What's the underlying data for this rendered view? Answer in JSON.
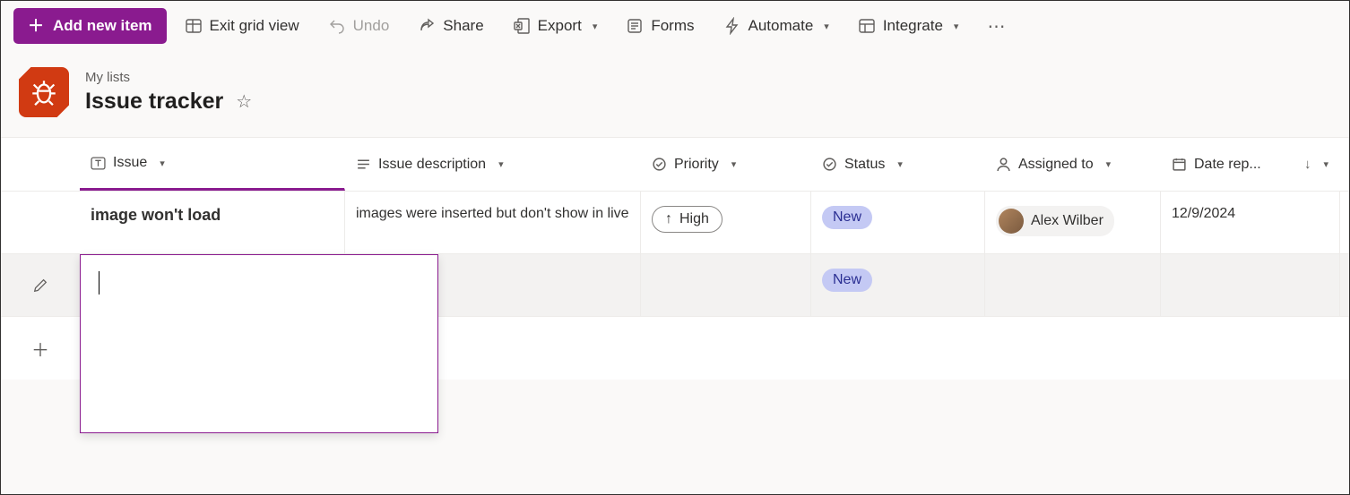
{
  "toolbar": {
    "add_label": "Add new item",
    "exit_grid": "Exit grid view",
    "undo": "Undo",
    "share": "Share",
    "export": "Export",
    "forms": "Forms",
    "automate": "Automate",
    "integrate": "Integrate"
  },
  "breadcrumb": "My lists",
  "title": "Issue tracker",
  "columns": {
    "issue": "Issue",
    "desc": "Issue description",
    "priority": "Priority",
    "status": "Status",
    "assigned": "Assigned to",
    "date": "Date rep..."
  },
  "rows": [
    {
      "issue": "image won't load",
      "desc": "images were inserted but don't show in live",
      "priority": "High",
      "status": "New",
      "assigned": "Alex Wilber",
      "date": "12/9/2024"
    },
    {
      "issue": "",
      "desc": "",
      "priority": "",
      "status": "New",
      "assigned": "",
      "date": ""
    }
  ]
}
